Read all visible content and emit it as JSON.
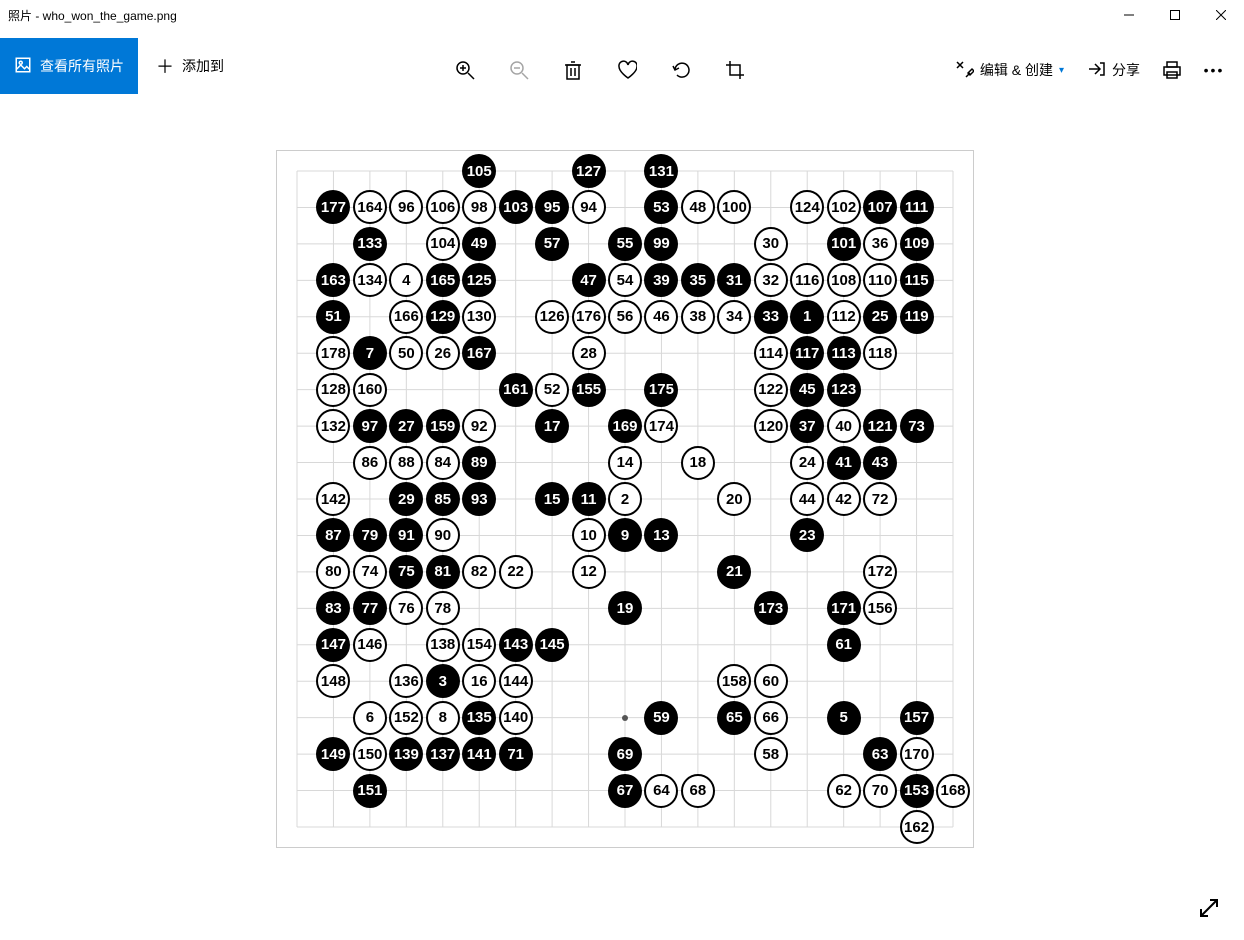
{
  "window": {
    "title": "照片 - who_won_the_game.png",
    "min": "—",
    "max": "☐",
    "close": "✕"
  },
  "toolbar": {
    "view_all": "查看所有照片",
    "add_to": "添加到",
    "edit_create": "编辑 & 创建",
    "share": "分享"
  },
  "icons": {
    "zoom_in": "zoom-in-icon",
    "zoom_out": "zoom-out-icon",
    "delete": "delete-icon",
    "favorite": "favorite-icon",
    "rotate": "rotate-icon",
    "crop": "crop-icon",
    "edit": "edit-icon",
    "share": "share-icon",
    "print": "print-icon",
    "more": "more-icon",
    "expand": "expand-icon",
    "plus": "plus-icon",
    "image": "image-icon"
  },
  "board": {
    "size": 19
  },
  "chart_data": {
    "type": "go-board",
    "size": 19,
    "note": "Odd move numbers = Black, even = White. Coordinates are (col,row) with 1=left/top.",
    "moves": [
      {
        "n": 105,
        "c": "B",
        "x": 6,
        "y": 1
      },
      {
        "n": 127,
        "c": "B",
        "x": 9,
        "y": 1
      },
      {
        "n": 131,
        "c": "B",
        "x": 11,
        "y": 1
      },
      {
        "n": 177,
        "c": "B",
        "x": 2,
        "y": 2
      },
      {
        "n": 164,
        "c": "W",
        "x": 3,
        "y": 2
      },
      {
        "n": 96,
        "c": "W",
        "x": 4,
        "y": 2
      },
      {
        "n": 106,
        "c": "W",
        "x": 5,
        "y": 2
      },
      {
        "n": 98,
        "c": "W",
        "x": 6,
        "y": 2
      },
      {
        "n": 103,
        "c": "B",
        "x": 7,
        "y": 2
      },
      {
        "n": 95,
        "c": "B",
        "x": 8,
        "y": 2
      },
      {
        "n": 94,
        "c": "W",
        "x": 9,
        "y": 2
      },
      {
        "n": 53,
        "c": "B",
        "x": 11,
        "y": 2
      },
      {
        "n": 48,
        "c": "W",
        "x": 12,
        "y": 2
      },
      {
        "n": 100,
        "c": "W",
        "x": 13,
        "y": 2
      },
      {
        "n": 124,
        "c": "W",
        "x": 15,
        "y": 2
      },
      {
        "n": 102,
        "c": "W",
        "x": 16,
        "y": 2
      },
      {
        "n": 107,
        "c": "B",
        "x": 17,
        "y": 2
      },
      {
        "n": 111,
        "c": "B",
        "x": 18,
        "y": 2
      },
      {
        "n": 133,
        "c": "B",
        "x": 3,
        "y": 3
      },
      {
        "n": 104,
        "c": "W",
        "x": 5,
        "y": 3
      },
      {
        "n": 49,
        "c": "B",
        "x": 6,
        "y": 3
      },
      {
        "n": 57,
        "c": "B",
        "x": 8,
        "y": 3
      },
      {
        "n": 55,
        "c": "B",
        "x": 10,
        "y": 3
      },
      {
        "n": 99,
        "c": "B",
        "x": 11,
        "y": 3
      },
      {
        "n": 30,
        "c": "W",
        "x": 14,
        "y": 3
      },
      {
        "n": 101,
        "c": "B",
        "x": 16,
        "y": 3
      },
      {
        "n": 36,
        "c": "W",
        "x": 17,
        "y": 3
      },
      {
        "n": 109,
        "c": "B",
        "x": 18,
        "y": 3
      },
      {
        "n": 163,
        "c": "B",
        "x": 2,
        "y": 4
      },
      {
        "n": 134,
        "c": "W",
        "x": 3,
        "y": 4
      },
      {
        "n": 4,
        "c": "W",
        "x": 4,
        "y": 4
      },
      {
        "n": 165,
        "c": "B",
        "x": 5,
        "y": 4
      },
      {
        "n": 125,
        "c": "B",
        "x": 6,
        "y": 4
      },
      {
        "n": 47,
        "c": "B",
        "x": 9,
        "y": 4
      },
      {
        "n": 54,
        "c": "W",
        "x": 10,
        "y": 4
      },
      {
        "n": 39,
        "c": "B",
        "x": 11,
        "y": 4
      },
      {
        "n": 35,
        "c": "B",
        "x": 12,
        "y": 4
      },
      {
        "n": 31,
        "c": "B",
        "x": 13,
        "y": 4
      },
      {
        "n": 32,
        "c": "W",
        "x": 14,
        "y": 4
      },
      {
        "n": 116,
        "c": "W",
        "x": 15,
        "y": 4
      },
      {
        "n": 108,
        "c": "W",
        "x": 16,
        "y": 4
      },
      {
        "n": 110,
        "c": "W",
        "x": 17,
        "y": 4
      },
      {
        "n": 115,
        "c": "B",
        "x": 18,
        "y": 4
      },
      {
        "n": 51,
        "c": "B",
        "x": 2,
        "y": 5
      },
      {
        "n": 166,
        "c": "W",
        "x": 4,
        "y": 5
      },
      {
        "n": 129,
        "c": "B",
        "x": 5,
        "y": 5
      },
      {
        "n": 130,
        "c": "W",
        "x": 6,
        "y": 5
      },
      {
        "n": 126,
        "c": "W",
        "x": 8,
        "y": 5
      },
      {
        "n": 176,
        "c": "W",
        "x": 9,
        "y": 5
      },
      {
        "n": 56,
        "c": "W",
        "x": 10,
        "y": 5
      },
      {
        "n": 46,
        "c": "W",
        "x": 11,
        "y": 5
      },
      {
        "n": 38,
        "c": "W",
        "x": 12,
        "y": 5
      },
      {
        "n": 34,
        "c": "W",
        "x": 13,
        "y": 5
      },
      {
        "n": 33,
        "c": "B",
        "x": 14,
        "y": 5
      },
      {
        "n": 1,
        "c": "B",
        "x": 15,
        "y": 5
      },
      {
        "n": 112,
        "c": "W",
        "x": 16,
        "y": 5
      },
      {
        "n": 25,
        "c": "B",
        "x": 17,
        "y": 5
      },
      {
        "n": 119,
        "c": "B",
        "x": 18,
        "y": 5
      },
      {
        "n": 178,
        "c": "W",
        "x": 2,
        "y": 6
      },
      {
        "n": 7,
        "c": "B",
        "x": 3,
        "y": 6
      },
      {
        "n": 50,
        "c": "W",
        "x": 4,
        "y": 6
      },
      {
        "n": 26,
        "c": "W",
        "x": 5,
        "y": 6
      },
      {
        "n": 167,
        "c": "B",
        "x": 6,
        "y": 6
      },
      {
        "n": 28,
        "c": "W",
        "x": 9,
        "y": 6
      },
      {
        "n": 114,
        "c": "W",
        "x": 14,
        "y": 6
      },
      {
        "n": 117,
        "c": "B",
        "x": 15,
        "y": 6
      },
      {
        "n": 113,
        "c": "B",
        "x": 16,
        "y": 6
      },
      {
        "n": 118,
        "c": "W",
        "x": 17,
        "y": 6
      },
      {
        "n": 128,
        "c": "W",
        "x": 2,
        "y": 7
      },
      {
        "n": 160,
        "c": "W",
        "x": 3,
        "y": 7
      },
      {
        "n": 161,
        "c": "B",
        "x": 7,
        "y": 7
      },
      {
        "n": 52,
        "c": "W",
        "x": 8,
        "y": 7
      },
      {
        "n": 155,
        "c": "B",
        "x": 9,
        "y": 7
      },
      {
        "n": 175,
        "c": "B",
        "x": 11,
        "y": 7
      },
      {
        "n": 122,
        "c": "W",
        "x": 14,
        "y": 7
      },
      {
        "n": 45,
        "c": "B",
        "x": 15,
        "y": 7
      },
      {
        "n": 123,
        "c": "B",
        "x": 16,
        "y": 7
      },
      {
        "n": 132,
        "c": "W",
        "x": 2,
        "y": 8
      },
      {
        "n": 97,
        "c": "B",
        "x": 3,
        "y": 8
      },
      {
        "n": 27,
        "c": "B",
        "x": 4,
        "y": 8
      },
      {
        "n": 159,
        "c": "B",
        "x": 5,
        "y": 8
      },
      {
        "n": 92,
        "c": "W",
        "x": 6,
        "y": 8
      },
      {
        "n": 17,
        "c": "B",
        "x": 8,
        "y": 8
      },
      {
        "n": 169,
        "c": "B",
        "x": 10,
        "y": 8
      },
      {
        "n": 174,
        "c": "W",
        "x": 11,
        "y": 8
      },
      {
        "n": 120,
        "c": "W",
        "x": 14,
        "y": 8
      },
      {
        "n": 37,
        "c": "B",
        "x": 15,
        "y": 8
      },
      {
        "n": 40,
        "c": "W",
        "x": 16,
        "y": 8
      },
      {
        "n": 121,
        "c": "B",
        "x": 17,
        "y": 8
      },
      {
        "n": 73,
        "c": "B",
        "x": 18,
        "y": 8
      },
      {
        "n": 86,
        "c": "W",
        "x": 3,
        "y": 9
      },
      {
        "n": 88,
        "c": "W",
        "x": 4,
        "y": 9
      },
      {
        "n": 84,
        "c": "W",
        "x": 5,
        "y": 9
      },
      {
        "n": 89,
        "c": "B",
        "x": 6,
        "y": 9
      },
      {
        "n": 14,
        "c": "W",
        "x": 10,
        "y": 9
      },
      {
        "n": 18,
        "c": "W",
        "x": 12,
        "y": 9
      },
      {
        "n": 24,
        "c": "W",
        "x": 15,
        "y": 9
      },
      {
        "n": 41,
        "c": "B",
        "x": 16,
        "y": 9
      },
      {
        "n": 43,
        "c": "B",
        "x": 17,
        "y": 9
      },
      {
        "n": 142,
        "c": "W",
        "x": 2,
        "y": 10
      },
      {
        "n": 29,
        "c": "B",
        "x": 4,
        "y": 10
      },
      {
        "n": 85,
        "c": "B",
        "x": 5,
        "y": 10
      },
      {
        "n": 93,
        "c": "B",
        "x": 6,
        "y": 10
      },
      {
        "n": 15,
        "c": "B",
        "x": 8,
        "y": 10
      },
      {
        "n": 11,
        "c": "B",
        "x": 9,
        "y": 10
      },
      {
        "n": 2,
        "c": "W",
        "x": 10,
        "y": 10
      },
      {
        "n": 20,
        "c": "W",
        "x": 13,
        "y": 10
      },
      {
        "n": 44,
        "c": "W",
        "x": 15,
        "y": 10
      },
      {
        "n": 42,
        "c": "W",
        "x": 16,
        "y": 10
      },
      {
        "n": 72,
        "c": "W",
        "x": 17,
        "y": 10
      },
      {
        "n": 87,
        "c": "B",
        "x": 2,
        "y": 11
      },
      {
        "n": 79,
        "c": "B",
        "x": 3,
        "y": 11
      },
      {
        "n": 91,
        "c": "B",
        "x": 4,
        "y": 11
      },
      {
        "n": 90,
        "c": "W",
        "x": 5,
        "y": 11
      },
      {
        "n": 10,
        "c": "W",
        "x": 9,
        "y": 11
      },
      {
        "n": 9,
        "c": "B",
        "x": 10,
        "y": 11
      },
      {
        "n": 13,
        "c": "B",
        "x": 11,
        "y": 11
      },
      {
        "n": 23,
        "c": "B",
        "x": 15,
        "y": 11
      },
      {
        "n": 80,
        "c": "W",
        "x": 2,
        "y": 12
      },
      {
        "n": 74,
        "c": "W",
        "x": 3,
        "y": 12
      },
      {
        "n": 75,
        "c": "B",
        "x": 4,
        "y": 12
      },
      {
        "n": 81,
        "c": "B",
        "x": 5,
        "y": 12
      },
      {
        "n": 82,
        "c": "W",
        "x": 6,
        "y": 12
      },
      {
        "n": 22,
        "c": "W",
        "x": 7,
        "y": 12
      },
      {
        "n": 12,
        "c": "W",
        "x": 9,
        "y": 12
      },
      {
        "n": 21,
        "c": "B",
        "x": 13,
        "y": 12
      },
      {
        "n": 172,
        "c": "W",
        "x": 17,
        "y": 12
      },
      {
        "n": 83,
        "c": "B",
        "x": 2,
        "y": 13
      },
      {
        "n": 77,
        "c": "B",
        "x": 3,
        "y": 13
      },
      {
        "n": 76,
        "c": "W",
        "x": 4,
        "y": 13
      },
      {
        "n": 78,
        "c": "W",
        "x": 5,
        "y": 13
      },
      {
        "n": 19,
        "c": "B",
        "x": 10,
        "y": 13
      },
      {
        "n": 173,
        "c": "B",
        "x": 14,
        "y": 13
      },
      {
        "n": 171,
        "c": "B",
        "x": 16,
        "y": 13
      },
      {
        "n": 156,
        "c": "W",
        "x": 17,
        "y": 13
      },
      {
        "n": 147,
        "c": "B",
        "x": 2,
        "y": 14
      },
      {
        "n": 146,
        "c": "W",
        "x": 3,
        "y": 14
      },
      {
        "n": 138,
        "c": "W",
        "x": 5,
        "y": 14
      },
      {
        "n": 154,
        "c": "W",
        "x": 6,
        "y": 14
      },
      {
        "n": 143,
        "c": "B",
        "x": 7,
        "y": 14
      },
      {
        "n": 145,
        "c": "B",
        "x": 8,
        "y": 14
      },
      {
        "n": 61,
        "c": "B",
        "x": 16,
        "y": 14
      },
      {
        "n": 148,
        "c": "W",
        "x": 2,
        "y": 15
      },
      {
        "n": 136,
        "c": "W",
        "x": 4,
        "y": 15
      },
      {
        "n": 3,
        "c": "B",
        "x": 5,
        "y": 15
      },
      {
        "n": 16,
        "c": "W",
        "x": 6,
        "y": 15
      },
      {
        "n": 144,
        "c": "W",
        "x": 7,
        "y": 15
      },
      {
        "n": 158,
        "c": "W",
        "x": 13,
        "y": 15
      },
      {
        "n": 60,
        "c": "W",
        "x": 14,
        "y": 15
      },
      {
        "n": 6,
        "c": "W",
        "x": 3,
        "y": 16
      },
      {
        "n": 152,
        "c": "W",
        "x": 4,
        "y": 16
      },
      {
        "n": 8,
        "c": "W",
        "x": 5,
        "y": 16
      },
      {
        "n": 135,
        "c": "B",
        "x": 6,
        "y": 16
      },
      {
        "n": 140,
        "c": "W",
        "x": 7,
        "y": 16
      },
      {
        "n": 59,
        "c": "B",
        "x": 11,
        "y": 16
      },
      {
        "n": 65,
        "c": "B",
        "x": 13,
        "y": 16
      },
      {
        "n": 66,
        "c": "W",
        "x": 14,
        "y": 16
      },
      {
        "n": 5,
        "c": "B",
        "x": 16,
        "y": 16
      },
      {
        "n": 157,
        "c": "B",
        "x": 18,
        "y": 16
      },
      {
        "n": 149,
        "c": "B",
        "x": 2,
        "y": 17
      },
      {
        "n": 150,
        "c": "W",
        "x": 3,
        "y": 17
      },
      {
        "n": 139,
        "c": "B",
        "x": 4,
        "y": 17
      },
      {
        "n": 137,
        "c": "B",
        "x": 5,
        "y": 17
      },
      {
        "n": 141,
        "c": "B",
        "x": 6,
        "y": 17
      },
      {
        "n": 71,
        "c": "B",
        "x": 7,
        "y": 17
      },
      {
        "n": 69,
        "c": "B",
        "x": 10,
        "y": 17
      },
      {
        "n": 58,
        "c": "W",
        "x": 14,
        "y": 17
      },
      {
        "n": 63,
        "c": "B",
        "x": 17,
        "y": 17
      },
      {
        "n": 170,
        "c": "W",
        "x": 18,
        "y": 17
      },
      {
        "n": 151,
        "c": "B",
        "x": 3,
        "y": 18
      },
      {
        "n": 67,
        "c": "B",
        "x": 10,
        "y": 18
      },
      {
        "n": 64,
        "c": "W",
        "x": 11,
        "y": 18
      },
      {
        "n": 68,
        "c": "W",
        "x": 12,
        "y": 18
      },
      {
        "n": 62,
        "c": "W",
        "x": 16,
        "y": 18
      },
      {
        "n": 70,
        "c": "W",
        "x": 17,
        "y": 18
      },
      {
        "n": 153,
        "c": "B",
        "x": 18,
        "y": 18
      },
      {
        "n": 168,
        "c": "W",
        "x": 19,
        "y": 18
      },
      {
        "n": 162,
        "c": "W",
        "x": 18,
        "y": 19
      }
    ],
    "star_points": [
      {
        "x": 10,
        "y": 16
      }
    ]
  }
}
